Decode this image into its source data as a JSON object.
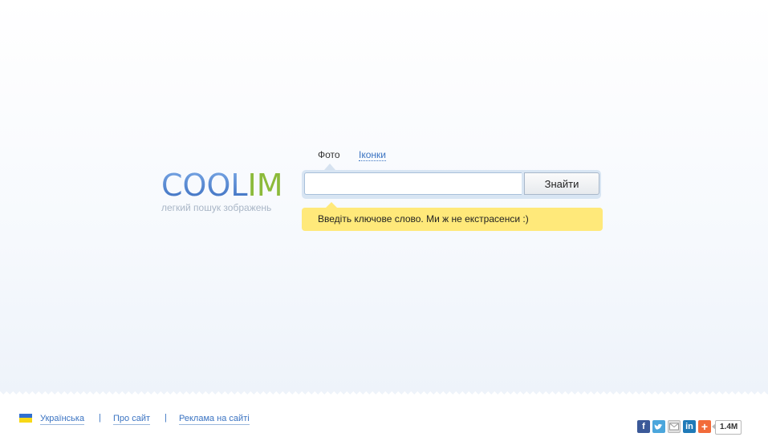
{
  "logo": {
    "part1": "COOL",
    "part2": "IM",
    "tagline": "легкий пошук зображень"
  },
  "tabs": [
    {
      "label": "Фото",
      "active": true
    },
    {
      "label": "Іконки",
      "active": false
    }
  ],
  "search": {
    "value": "",
    "placeholder": "",
    "button_label": "Знайти"
  },
  "hint": {
    "text": "Введіть ключове слово. Ми ж не екстрасенси :)"
  },
  "footer": {
    "links": [
      {
        "label": "Українська"
      },
      {
        "label": "Про сайт"
      },
      {
        "label": "Реклама на сайті"
      }
    ],
    "separator": "|"
  },
  "share": {
    "icons": [
      "facebook-icon",
      "twitter-icon",
      "mail-icon",
      "linkedin-icon",
      "plus-icon"
    ],
    "count": "1.4M"
  },
  "colors": {
    "logo_blue": "#5a8fd6",
    "logo_green": "#8cba3a",
    "link": "#3a73c2",
    "hint_bg": "#ffe97a"
  }
}
